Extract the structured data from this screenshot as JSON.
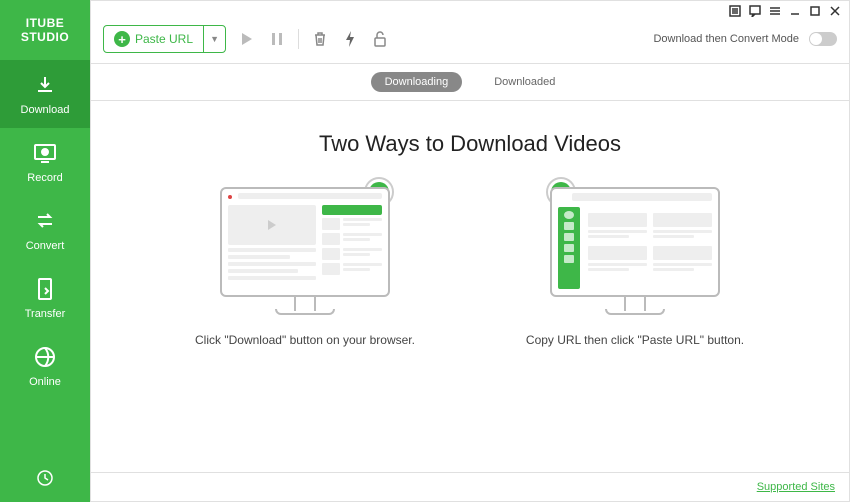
{
  "app": {
    "name": "ITUBE STUDIO"
  },
  "sidebar": {
    "items": [
      {
        "label": "Download"
      },
      {
        "label": "Record"
      },
      {
        "label": "Convert"
      },
      {
        "label": "Transfer"
      },
      {
        "label": "Online"
      }
    ]
  },
  "toolbar": {
    "paste_url": "Paste URL",
    "convert_mode": "Download then Convert Mode"
  },
  "tabs": {
    "downloading": "Downloading",
    "downloaded": "Downloaded"
  },
  "content": {
    "heading": "Two Ways to Download Videos",
    "method1": "Click \"Download\" button on your browser.",
    "method2": "Copy URL then click \"Paste URL\" button."
  },
  "footer": {
    "supported_sites": "Supported Sites"
  }
}
